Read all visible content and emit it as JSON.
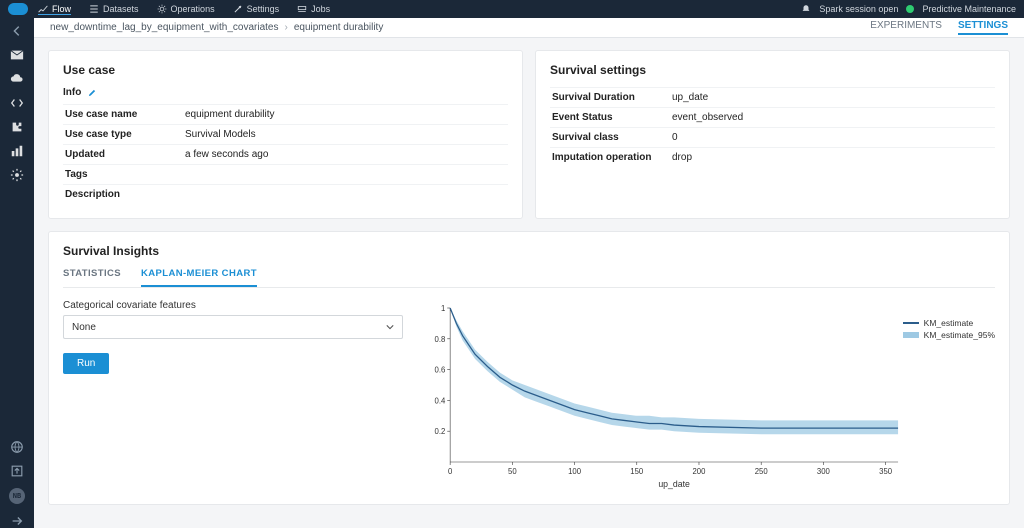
{
  "nav": {
    "items": [
      {
        "name": "flow",
        "label": "Flow"
      },
      {
        "name": "datasets",
        "label": "Datasets"
      },
      {
        "name": "operations",
        "label": "Operations"
      },
      {
        "name": "settings",
        "label": "Settings"
      },
      {
        "name": "jobs",
        "label": "Jobs"
      }
    ],
    "spark_label": "Spark session open",
    "project_label": "Predictive Maintenance"
  },
  "crumb": {
    "parent": "new_downtime_lag_by_equipment_with_covariates",
    "current": "equipment durability"
  },
  "subtabs": {
    "experiments": "EXPERIMENTS",
    "settings": "SETTINGS"
  },
  "usecase": {
    "title": "Use case",
    "info_label": "Info",
    "rows": {
      "name_k": "Use case name",
      "name_v": "equipment durability",
      "type_k": "Use case type",
      "type_v": "Survival Models",
      "updated_k": "Updated",
      "updated_v": "a few seconds ago",
      "tags_k": "Tags",
      "tags_v": "",
      "desc_k": "Description",
      "desc_v": ""
    }
  },
  "survival": {
    "title": "Survival settings",
    "rows": {
      "dur_k": "Survival Duration",
      "dur_v": "up_date",
      "status_k": "Event Status",
      "status_v": "event_observed",
      "class_k": "Survival class",
      "class_v": "0",
      "imp_k": "Imputation operation",
      "imp_v": "drop"
    }
  },
  "insights": {
    "title": "Survival Insights",
    "tab_stats": "STATISTICS",
    "tab_km": "KAPLAN-MEIER CHART",
    "cov_label": "Categorical covariate features",
    "select_value": "None",
    "run_label": "Run",
    "legend_line": "KM_estimate",
    "legend_area": "KM_estimate_95%"
  },
  "chart_data": {
    "type": "line",
    "title": "",
    "xlabel": "up_date",
    "ylabel": "",
    "xlim": [
      0,
      360
    ],
    "ylim": [
      0,
      1
    ],
    "xticks": [
      0,
      50,
      100,
      150,
      200,
      250,
      300,
      350
    ],
    "yticks": [
      0.2,
      0.4,
      0.6,
      0.8,
      1
    ],
    "series": [
      {
        "name": "KM_estimate",
        "x": [
          0,
          5,
          10,
          15,
          20,
          30,
          40,
          50,
          60,
          70,
          80,
          90,
          100,
          110,
          120,
          130,
          140,
          150,
          160,
          170,
          180,
          200,
          250,
          300,
          350,
          360
        ],
        "y": [
          1.0,
          0.9,
          0.82,
          0.76,
          0.7,
          0.62,
          0.55,
          0.5,
          0.46,
          0.43,
          0.4,
          0.37,
          0.34,
          0.32,
          0.3,
          0.28,
          0.27,
          0.26,
          0.25,
          0.25,
          0.24,
          0.23,
          0.22,
          0.22,
          0.22,
          0.22
        ]
      },
      {
        "name": "KM_estimate_95%_upper",
        "x": [
          0,
          5,
          10,
          15,
          20,
          30,
          40,
          50,
          60,
          70,
          80,
          90,
          100,
          110,
          120,
          130,
          140,
          150,
          160,
          170,
          180,
          200,
          250,
          300,
          350,
          360
        ],
        "y": [
          1.0,
          0.92,
          0.85,
          0.79,
          0.73,
          0.65,
          0.58,
          0.53,
          0.5,
          0.47,
          0.44,
          0.41,
          0.38,
          0.36,
          0.34,
          0.32,
          0.31,
          0.3,
          0.3,
          0.29,
          0.29,
          0.28,
          0.27,
          0.27,
          0.27,
          0.27
        ]
      },
      {
        "name": "KM_estimate_95%_lower",
        "x": [
          0,
          5,
          10,
          15,
          20,
          30,
          40,
          50,
          60,
          70,
          80,
          90,
          100,
          110,
          120,
          130,
          140,
          150,
          160,
          170,
          180,
          200,
          250,
          300,
          350,
          360
        ],
        "y": [
          1.0,
          0.88,
          0.79,
          0.73,
          0.67,
          0.59,
          0.52,
          0.47,
          0.42,
          0.39,
          0.36,
          0.33,
          0.3,
          0.28,
          0.26,
          0.24,
          0.23,
          0.22,
          0.21,
          0.21,
          0.2,
          0.19,
          0.18,
          0.18,
          0.18,
          0.18
        ]
      }
    ]
  },
  "rail_nb": "NB"
}
